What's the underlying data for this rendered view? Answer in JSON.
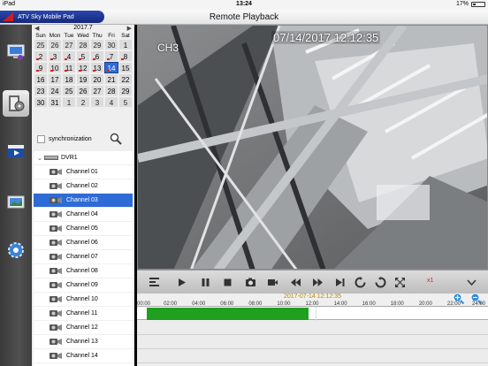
{
  "status_bar": {
    "device": "iPad",
    "time": "13:24",
    "battery": "17%"
  },
  "app": {
    "brand": "ATV Sky Mobile Pad",
    "title": "Remote Playback"
  },
  "nav": [
    {
      "name": "live-view",
      "icon": "monitor-icon"
    },
    {
      "name": "playback",
      "icon": "film-reel-icon",
      "active": true
    },
    {
      "name": "local-playback",
      "icon": "clapper-icon"
    },
    {
      "name": "image-browser",
      "icon": "picture-icon"
    },
    {
      "name": "settings",
      "icon": "gear-globe-icon"
    }
  ],
  "calendar": {
    "month": "2017.7",
    "prev": "◀",
    "next": "▶",
    "weekdays": [
      "Sun",
      "Mon",
      "Tue",
      "Wed",
      "Thu",
      "Fri",
      "Sat"
    ],
    "weeks": [
      [
        "25",
        "26",
        "27",
        "28",
        "29",
        "30",
        "1"
      ],
      [
        "2",
        "3",
        "4",
        "5",
        "6",
        "7",
        "8"
      ],
      [
        "9",
        "10",
        "11",
        "12",
        "13",
        "14",
        "15"
      ],
      [
        "16",
        "17",
        "18",
        "19",
        "20",
        "21",
        "22"
      ],
      [
        "23",
        "24",
        "25",
        "26",
        "27",
        "28",
        "29"
      ],
      [
        "30",
        "31",
        "1",
        "2",
        "3",
        "4",
        "5"
      ]
    ],
    "selected": "14"
  },
  "sync": {
    "label": "synchronization"
  },
  "tree": {
    "dvr": "DVR1",
    "channels": [
      "Channel 01",
      "Channel 02",
      "Channel 03",
      "Channel 04",
      "Channel 05",
      "Channel 06",
      "Channel 07",
      "Channel 08",
      "Channel 09",
      "Channel 10",
      "Channel 11",
      "Channel 12",
      "Channel 13",
      "Channel 14"
    ],
    "selected_index": 2
  },
  "video": {
    "channel": "CH3",
    "timestamp": "07/14/2017 12:12:35"
  },
  "controls": {
    "speed": "x1"
  },
  "timeline": {
    "datetime": "2017-07-14 12:12:35",
    "ticks": [
      "00:00",
      "02:00",
      "04:00",
      "06:00",
      "08:00",
      "10:00",
      "12:00",
      "14:00",
      "16:00",
      "18:00",
      "20:00",
      "22:00",
      "24:00"
    ],
    "record_segment_hours": [
      0.3,
      11.7
    ],
    "cursor_hour": 12.21,
    "colors": {
      "record": "#1fa01f",
      "date": "#b58a00"
    }
  }
}
